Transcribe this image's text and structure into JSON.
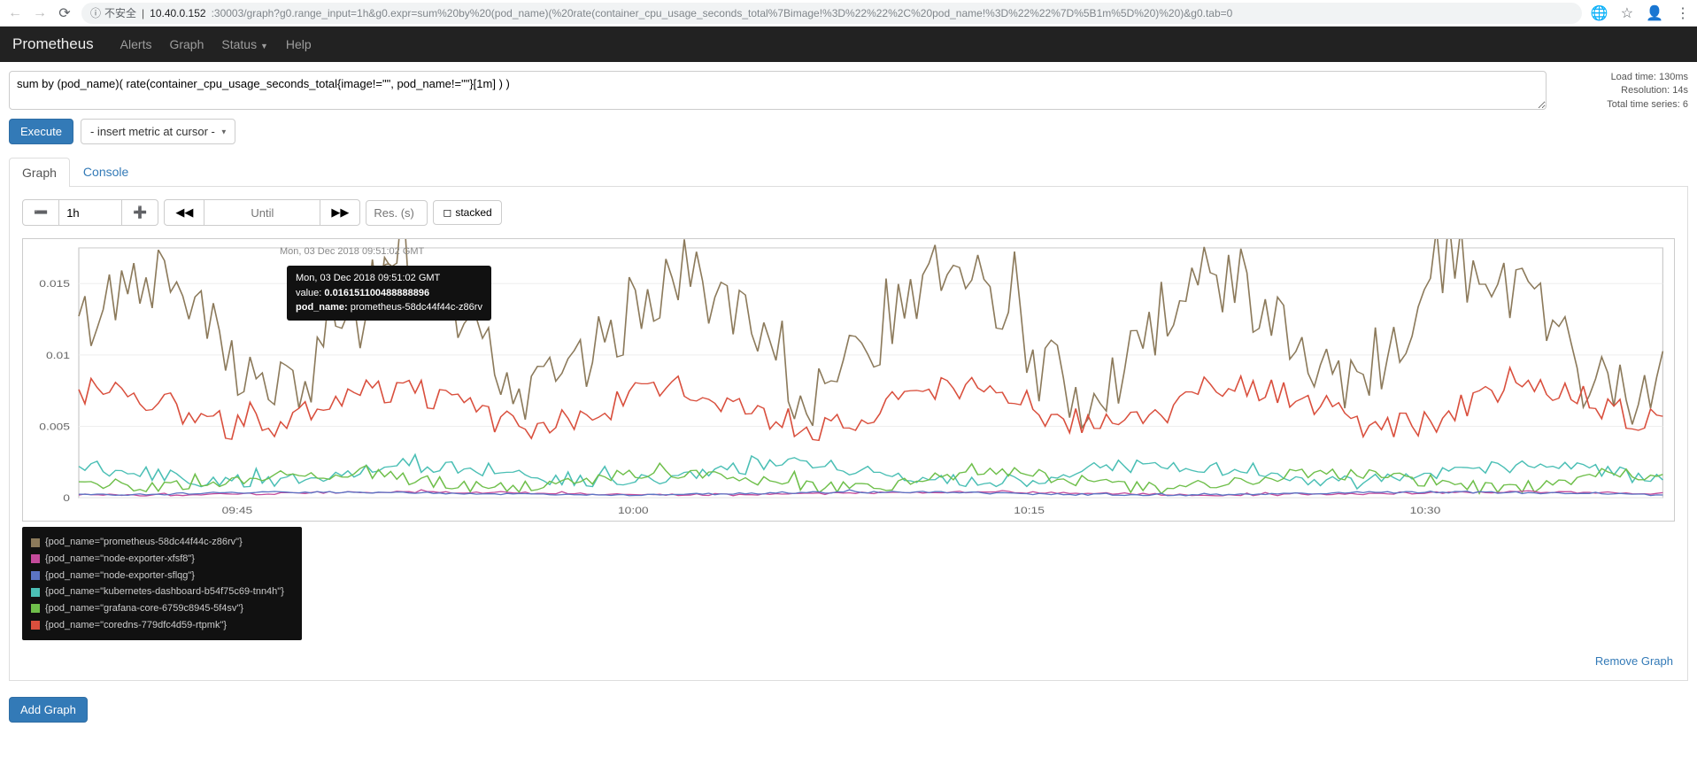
{
  "browser": {
    "insecure_label": "不安全",
    "url_host": "10.40.0.152",
    "url_rest": ":30003/graph?g0.range_input=1h&g0.expr=sum%20by%20(pod_name)(%20rate(container_cpu_usage_seconds_total%7Bimage!%3D%22%22%2C%20pod_name!%3D%22%22%7D%5B1m%5D%20)%20)&g0.tab=0"
  },
  "nav": {
    "brand": "Prometheus",
    "alerts": "Alerts",
    "graph": "Graph",
    "status": "Status",
    "help": "Help"
  },
  "expr_value": "sum by (pod_name)( rate(container_cpu_usage_seconds_total{image!=\"\", pod_name!=\"\"}[1m] ) )",
  "stats": {
    "load_time": "Load time: 130ms",
    "resolution": "Resolution: 14s",
    "total_series": "Total time series: 6"
  },
  "buttons": {
    "execute": "Execute",
    "metric_select": "- insert metric at cursor -",
    "stacked": "stacked",
    "add_graph": "Add Graph",
    "remove_graph": "Remove Graph"
  },
  "tabs": {
    "graph": "Graph",
    "console": "Console"
  },
  "controls": {
    "range": "1h",
    "until_placeholder": "Until",
    "res_placeholder": "Res. (s)"
  },
  "timestamp": "Mon, 03 Dec 2018 09:51:02 GMT",
  "tooltip": {
    "ts": "Mon, 03 Dec 2018 09:51:02 GMT",
    "value_label": "value:",
    "value": "0.016151100488888896",
    "podname_label": "pod_name:",
    "podname": "prometheus-58dc44f44c-z86rv"
  },
  "legend": [
    {
      "color": "#8c7a5b",
      "label": "{pod_name=\"prometheus-58dc44f44c-z86rv\"}"
    },
    {
      "color": "#c44b9b",
      "label": "{pod_name=\"node-exporter-xfsf8\"}"
    },
    {
      "color": "#5b74c4",
      "label": "{pod_name=\"node-exporter-sflqg\"}"
    },
    {
      "color": "#4bbfb5",
      "label": "{pod_name=\"kubernetes-dashboard-b54f75c69-tnn4h\"}"
    },
    {
      "color": "#6fbf4b",
      "label": "{pod_name=\"grafana-core-6759c8945-5f4sv\"}"
    },
    {
      "color": "#d94f3d",
      "label": "{pod_name=\"coredns-779dfc4d59-rtpmk\"}"
    }
  ],
  "chart_data": {
    "type": "line",
    "xlabel": "",
    "ylabel": "",
    "ylim": [
      0,
      0.0175
    ],
    "y_ticks": [
      0,
      0.005,
      0.01,
      0.015
    ],
    "x_tick_labels": [
      "09:45",
      "10:00",
      "10:15",
      "10:30"
    ],
    "x_tick_positions": [
      0.1,
      0.35,
      0.6,
      0.85
    ],
    "series": [
      {
        "name": "prometheus-58dc44f44c-z86rv",
        "color": "#8c7a5b",
        "mean": 0.0115,
        "amp": 0.004,
        "freq": 62,
        "noise": 0.3
      },
      {
        "name": "coredns-779dfc4d59-rtpmk",
        "color": "#d94f3d",
        "mean": 0.0063,
        "amp": 0.0013,
        "freq": 58,
        "noise": 0.35
      },
      {
        "name": "kubernetes-dashboard-b54f75c69-tnn4h",
        "color": "#4bbfb5",
        "mean": 0.0017,
        "amp": 0.0006,
        "freq": 45,
        "noise": 0.4
      },
      {
        "name": "grafana-core-6759c8945-5f4sv",
        "color": "#6fbf4b",
        "mean": 0.0012,
        "amp": 0.0005,
        "freq": 50,
        "noise": 0.4
      },
      {
        "name": "node-exporter-xfsf8",
        "color": "#c44b9b",
        "mean": 0.0003,
        "amp": 0.0001,
        "freq": 30,
        "noise": 0.3
      },
      {
        "name": "node-exporter-sflqg",
        "color": "#5b74c4",
        "mean": 0.0003,
        "amp": 0.0001,
        "freq": 30,
        "noise": 0.3
      }
    ],
    "tooltip_point": {
      "series": "prometheus-58dc44f44c-z86rv",
      "x_frac": 0.195,
      "y": 0.01615
    }
  }
}
